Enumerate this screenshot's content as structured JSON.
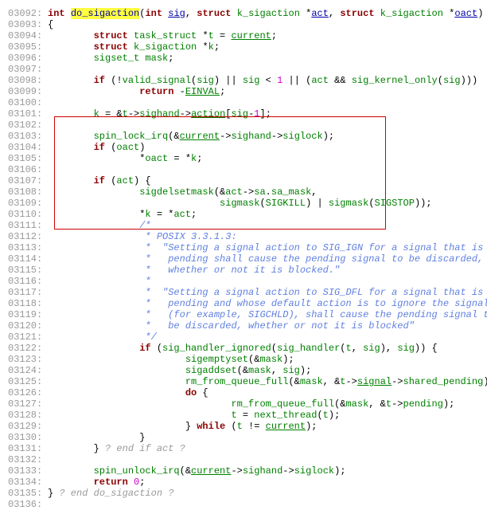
{
  "lines": [
    {
      "no": "03092:",
      "indent": 0,
      "segs": [
        {
          "c": "kw",
          "t": "int"
        },
        {
          "c": "plain",
          "t": " "
        },
        {
          "c": "defname",
          "t": "do_sigaction"
        },
        {
          "c": "plain",
          "t": "("
        },
        {
          "c": "kw",
          "t": "int"
        },
        {
          "c": "plain",
          "t": " "
        },
        {
          "c": "param",
          "t": "sig"
        },
        {
          "c": "plain",
          "t": ", "
        },
        {
          "c": "kw",
          "t": "struct"
        },
        {
          "c": "plain",
          "t": " "
        },
        {
          "c": "ident",
          "t": "k_sigaction"
        },
        {
          "c": "plain",
          "t": " *"
        },
        {
          "c": "param",
          "t": "act"
        },
        {
          "c": "plain",
          "t": ", "
        },
        {
          "c": "kw",
          "t": "struct"
        },
        {
          "c": "plain",
          "t": " "
        },
        {
          "c": "ident",
          "t": "k_sigaction"
        },
        {
          "c": "plain",
          "t": " *"
        },
        {
          "c": "param",
          "t": "oact"
        },
        {
          "c": "plain",
          "t": ")"
        }
      ]
    },
    {
      "no": "03093:",
      "indent": 0,
      "segs": [
        {
          "c": "plain",
          "t": "{"
        }
      ]
    },
    {
      "no": "03094:",
      "indent": 8,
      "segs": [
        {
          "c": "kw",
          "t": "struct"
        },
        {
          "c": "plain",
          "t": " "
        },
        {
          "c": "ident",
          "t": "task_struct"
        },
        {
          "c": "plain",
          "t": " *"
        },
        {
          "c": "ident",
          "t": "t"
        },
        {
          "c": "plain",
          "t": " = "
        },
        {
          "c": "ident-u",
          "t": "current"
        },
        {
          "c": "plain",
          "t": ";"
        }
      ]
    },
    {
      "no": "03095:",
      "indent": 8,
      "segs": [
        {
          "c": "kw",
          "t": "struct"
        },
        {
          "c": "plain",
          "t": " "
        },
        {
          "c": "ident",
          "t": "k_sigaction"
        },
        {
          "c": "plain",
          "t": " *"
        },
        {
          "c": "ident",
          "t": "k"
        },
        {
          "c": "plain",
          "t": ";"
        }
      ]
    },
    {
      "no": "03096:",
      "indent": 8,
      "segs": [
        {
          "c": "ident",
          "t": "sigset_t"
        },
        {
          "c": "plain",
          "t": " "
        },
        {
          "c": "ident",
          "t": "mask"
        },
        {
          "c": "plain",
          "t": ";"
        }
      ]
    },
    {
      "no": "03097:",
      "indent": 0,
      "segs": []
    },
    {
      "no": "03098:",
      "indent": 8,
      "segs": [
        {
          "c": "kw",
          "t": "if"
        },
        {
          "c": "plain",
          "t": " (!"
        },
        {
          "c": "ident",
          "t": "valid_signal"
        },
        {
          "c": "plain",
          "t": "("
        },
        {
          "c": "ident",
          "t": "sig"
        },
        {
          "c": "plain",
          "t": ") || "
        },
        {
          "c": "ident",
          "t": "sig"
        },
        {
          "c": "plain",
          "t": " < "
        },
        {
          "c": "num",
          "t": "1"
        },
        {
          "c": "plain",
          "t": " || ("
        },
        {
          "c": "ident",
          "t": "act"
        },
        {
          "c": "plain",
          "t": " && "
        },
        {
          "c": "ident",
          "t": "sig_kernel_only"
        },
        {
          "c": "plain",
          "t": "("
        },
        {
          "c": "ident",
          "t": "sig"
        },
        {
          "c": "plain",
          "t": ")))"
        }
      ]
    },
    {
      "no": "03099:",
      "indent": 16,
      "segs": [
        {
          "c": "kw",
          "t": "return"
        },
        {
          "c": "plain",
          "t": " -"
        },
        {
          "c": "ident-u",
          "t": "EINVAL"
        },
        {
          "c": "plain",
          "t": ";"
        }
      ]
    },
    {
      "no": "03100:",
      "indent": 0,
      "segs": []
    },
    {
      "no": "03101:",
      "indent": 8,
      "segs": [
        {
          "c": "ident",
          "t": "k"
        },
        {
          "c": "plain",
          "t": " = &"
        },
        {
          "c": "ident",
          "t": "t"
        },
        {
          "c": "plain",
          "t": "->"
        },
        {
          "c": "ident",
          "t": "sighand"
        },
        {
          "c": "plain",
          "t": "->"
        },
        {
          "c": "ident-u",
          "t": "action"
        },
        {
          "c": "plain",
          "t": "["
        },
        {
          "c": "ident",
          "t": "sig"
        },
        {
          "c": "plain",
          "t": "-"
        },
        {
          "c": "num",
          "t": "1"
        },
        {
          "c": "plain",
          "t": "];"
        }
      ]
    },
    {
      "no": "03102:",
      "indent": 0,
      "segs": []
    },
    {
      "no": "03103:",
      "indent": 8,
      "segs": [
        {
          "c": "ident",
          "t": "spin_lock_irq"
        },
        {
          "c": "plain",
          "t": "(&"
        },
        {
          "c": "ident-u",
          "t": "current"
        },
        {
          "c": "plain",
          "t": "->"
        },
        {
          "c": "ident",
          "t": "sighand"
        },
        {
          "c": "plain",
          "t": "->"
        },
        {
          "c": "ident",
          "t": "siglock"
        },
        {
          "c": "plain",
          "t": ");"
        }
      ]
    },
    {
      "no": "03104:",
      "indent": 8,
      "segs": [
        {
          "c": "kw",
          "t": "if"
        },
        {
          "c": "plain",
          "t": " ("
        },
        {
          "c": "ident",
          "t": "oact"
        },
        {
          "c": "plain",
          "t": ")"
        }
      ]
    },
    {
      "no": "03105:",
      "indent": 16,
      "segs": [
        {
          "c": "plain",
          "t": "*"
        },
        {
          "c": "ident",
          "t": "oact"
        },
        {
          "c": "plain",
          "t": " = *"
        },
        {
          "c": "ident",
          "t": "k"
        },
        {
          "c": "plain",
          "t": ";"
        }
      ]
    },
    {
      "no": "03106:",
      "indent": 0,
      "segs": []
    },
    {
      "no": "03107:",
      "indent": 8,
      "segs": [
        {
          "c": "kw",
          "t": "if"
        },
        {
          "c": "plain",
          "t": " ("
        },
        {
          "c": "ident",
          "t": "act"
        },
        {
          "c": "plain",
          "t": ") {"
        }
      ]
    },
    {
      "no": "03108:",
      "indent": 16,
      "segs": [
        {
          "c": "ident",
          "t": "sigdelsetmask"
        },
        {
          "c": "plain",
          "t": "(&"
        },
        {
          "c": "ident",
          "t": "act"
        },
        {
          "c": "plain",
          "t": "->"
        },
        {
          "c": "ident",
          "t": "sa"
        },
        {
          "c": "plain",
          "t": "."
        },
        {
          "c": "ident",
          "t": "sa_mask"
        },
        {
          "c": "plain",
          "t": ","
        }
      ]
    },
    {
      "no": "03109:",
      "indent": 30,
      "segs": [
        {
          "c": "ident",
          "t": "sigmask"
        },
        {
          "c": "plain",
          "t": "("
        },
        {
          "c": "macro",
          "t": "SIGKILL"
        },
        {
          "c": "plain",
          "t": ") | "
        },
        {
          "c": "ident",
          "t": "sigmask"
        },
        {
          "c": "plain",
          "t": "("
        },
        {
          "c": "macro",
          "t": "SIGSTOP"
        },
        {
          "c": "plain",
          "t": "));"
        }
      ]
    },
    {
      "no": "03110:",
      "indent": 16,
      "segs": [
        {
          "c": "plain",
          "t": "*"
        },
        {
          "c": "ident",
          "t": "k"
        },
        {
          "c": "plain",
          "t": " = *"
        },
        {
          "c": "ident",
          "t": "act"
        },
        {
          "c": "plain",
          "t": ";"
        }
      ]
    },
    {
      "no": "03111:",
      "indent": 16,
      "segs": [
        {
          "c": "comment",
          "t": "/*"
        }
      ]
    },
    {
      "no": "03112:",
      "indent": 16,
      "segs": [
        {
          "c": "comment",
          "t": " * POSIX 3.3.1.3:"
        }
      ]
    },
    {
      "no": "03113:",
      "indent": 16,
      "segs": [
        {
          "c": "comment",
          "t": " *  \"Setting a signal action to SIG_IGN for a signal that is"
        }
      ]
    },
    {
      "no": "03114:",
      "indent": 16,
      "segs": [
        {
          "c": "comment",
          "t": " *   pending shall cause the pending signal to be discarded,"
        }
      ]
    },
    {
      "no": "03115:",
      "indent": 16,
      "segs": [
        {
          "c": "comment",
          "t": " *   whether or not it is blocked.\""
        }
      ]
    },
    {
      "no": "03116:",
      "indent": 16,
      "segs": [
        {
          "c": "comment",
          "t": " *"
        }
      ]
    },
    {
      "no": "03117:",
      "indent": 16,
      "segs": [
        {
          "c": "comment",
          "t": " *  \"Setting a signal action to SIG_DFL for a signal that is"
        }
      ]
    },
    {
      "no": "03118:",
      "indent": 16,
      "segs": [
        {
          "c": "comment",
          "t": " *   pending and whose default action is to ignore the signal"
        }
      ]
    },
    {
      "no": "03119:",
      "indent": 16,
      "segs": [
        {
          "c": "comment",
          "t": " *   (for example, SIGCHLD), shall cause the pending signal to"
        }
      ]
    },
    {
      "no": "03120:",
      "indent": 16,
      "segs": [
        {
          "c": "comment",
          "t": " *   be discarded, whether or not it is blocked\""
        }
      ]
    },
    {
      "no": "03121:",
      "indent": 16,
      "segs": [
        {
          "c": "comment",
          "t": " */"
        }
      ]
    },
    {
      "no": "03122:",
      "indent": 16,
      "segs": [
        {
          "c": "kw",
          "t": "if"
        },
        {
          "c": "plain",
          "t": " ("
        },
        {
          "c": "ident",
          "t": "sig_handler_ignored"
        },
        {
          "c": "plain",
          "t": "("
        },
        {
          "c": "ident",
          "t": "sig_handler"
        },
        {
          "c": "plain",
          "t": "("
        },
        {
          "c": "ident",
          "t": "t"
        },
        {
          "c": "plain",
          "t": ", "
        },
        {
          "c": "ident",
          "t": "sig"
        },
        {
          "c": "plain",
          "t": "), "
        },
        {
          "c": "ident",
          "t": "sig"
        },
        {
          "c": "plain",
          "t": ")) {"
        }
      ]
    },
    {
      "no": "03123:",
      "indent": 24,
      "segs": [
        {
          "c": "ident",
          "t": "sigemptyset"
        },
        {
          "c": "plain",
          "t": "(&"
        },
        {
          "c": "ident",
          "t": "mask"
        },
        {
          "c": "plain",
          "t": ");"
        }
      ]
    },
    {
      "no": "03124:",
      "indent": 24,
      "segs": [
        {
          "c": "ident",
          "t": "sigaddset"
        },
        {
          "c": "plain",
          "t": "(&"
        },
        {
          "c": "ident",
          "t": "mask"
        },
        {
          "c": "plain",
          "t": ", "
        },
        {
          "c": "ident",
          "t": "sig"
        },
        {
          "c": "plain",
          "t": ");"
        }
      ]
    },
    {
      "no": "03125:",
      "indent": 24,
      "segs": [
        {
          "c": "ident",
          "t": "rm_from_queue_full"
        },
        {
          "c": "plain",
          "t": "(&"
        },
        {
          "c": "ident",
          "t": "mask"
        },
        {
          "c": "plain",
          "t": ", &"
        },
        {
          "c": "ident",
          "t": "t"
        },
        {
          "c": "plain",
          "t": "->"
        },
        {
          "c": "ident-u",
          "t": "signal"
        },
        {
          "c": "plain",
          "t": "->"
        },
        {
          "c": "ident",
          "t": "shared_pending"
        },
        {
          "c": "plain",
          "t": ");"
        }
      ]
    },
    {
      "no": "03126:",
      "indent": 24,
      "segs": [
        {
          "c": "kw",
          "t": "do"
        },
        {
          "c": "plain",
          "t": " {"
        }
      ]
    },
    {
      "no": "03127:",
      "indent": 32,
      "segs": [
        {
          "c": "ident",
          "t": "rm_from_queue_full"
        },
        {
          "c": "plain",
          "t": "(&"
        },
        {
          "c": "ident",
          "t": "mask"
        },
        {
          "c": "plain",
          "t": ", &"
        },
        {
          "c": "ident",
          "t": "t"
        },
        {
          "c": "plain",
          "t": "->"
        },
        {
          "c": "ident",
          "t": "pending"
        },
        {
          "c": "plain",
          "t": ");"
        }
      ]
    },
    {
      "no": "03128:",
      "indent": 32,
      "segs": [
        {
          "c": "ident",
          "t": "t"
        },
        {
          "c": "plain",
          "t": " = "
        },
        {
          "c": "ident",
          "t": "next_thread"
        },
        {
          "c": "plain",
          "t": "("
        },
        {
          "c": "ident",
          "t": "t"
        },
        {
          "c": "plain",
          "t": ");"
        }
      ]
    },
    {
      "no": "03129:",
      "indent": 24,
      "segs": [
        {
          "c": "plain",
          "t": "} "
        },
        {
          "c": "kw",
          "t": "while"
        },
        {
          "c": "plain",
          "t": " ("
        },
        {
          "c": "ident",
          "t": "t"
        },
        {
          "c": "plain",
          "t": " != "
        },
        {
          "c": "ident-u",
          "t": "current"
        },
        {
          "c": "plain",
          "t": ");"
        }
      ]
    },
    {
      "no": "03130:",
      "indent": 16,
      "segs": [
        {
          "c": "plain",
          "t": "}"
        }
      ]
    },
    {
      "no": "03131:",
      "indent": 8,
      "segs": [
        {
          "c": "plain",
          "t": "} "
        },
        {
          "c": "comment-q",
          "t": "? end if act ?"
        }
      ]
    },
    {
      "no": "03132:",
      "indent": 0,
      "segs": []
    },
    {
      "no": "03133:",
      "indent": 8,
      "segs": [
        {
          "c": "ident",
          "t": "spin_unlock_irq"
        },
        {
          "c": "plain",
          "t": "(&"
        },
        {
          "c": "ident-u",
          "t": "current"
        },
        {
          "c": "plain",
          "t": "->"
        },
        {
          "c": "ident",
          "t": "sighand"
        },
        {
          "c": "plain",
          "t": "->"
        },
        {
          "c": "ident",
          "t": "siglock"
        },
        {
          "c": "plain",
          "t": ");"
        }
      ]
    },
    {
      "no": "03134:",
      "indent": 8,
      "segs": [
        {
          "c": "kw",
          "t": "return"
        },
        {
          "c": "plain",
          "t": " "
        },
        {
          "c": "num",
          "t": "0"
        },
        {
          "c": "plain",
          "t": ";"
        }
      ]
    },
    {
      "no": "03135:",
      "indent": 0,
      "segs": [
        {
          "c": "plain",
          "t": "} "
        },
        {
          "c": "comment-q",
          "t": "? end do_sigaction ?"
        }
      ]
    },
    {
      "no": "03136:",
      "indent": 0,
      "segs": []
    }
  ]
}
